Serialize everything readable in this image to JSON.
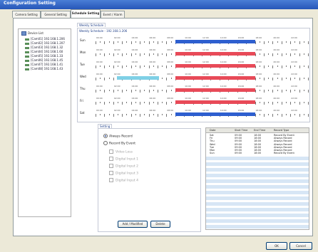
{
  "window": {
    "title": "Configuration Setting"
  },
  "tabs": [
    {
      "label": "Camera Setting",
      "active": false
    },
    {
      "label": "General Setting",
      "active": false
    },
    {
      "label": "Schedule Setting",
      "active": true
    },
    {
      "label": "Event / Alarm",
      "active": false
    }
  ],
  "device_list": {
    "root_label": "Device List",
    "items": [
      {
        "label": "[Cam01] 192.168.1.206"
      },
      {
        "label": "[Cam02] 192.168.1.207"
      },
      {
        "label": "[Cam03] 192.168.1.32"
      },
      {
        "label": "[Cam04] 192.168.1.60"
      },
      {
        "label": "[Cam05] 192.168.1.33"
      },
      {
        "label": "[Cam06] 192.168.1.45"
      },
      {
        "label": "[Cam07] 192.168.1.41"
      },
      {
        "label": "[Cam08] 192.168.1.43"
      }
    ]
  },
  "weekly": {
    "group_title": "Weekly Schedule",
    "subtitle": "Weekly Schedule - 192.168.1.206",
    "tick_labels": [
      "00:00",
      "02:00",
      "04:00",
      "06:00",
      "08:00",
      "10:00",
      "12:00",
      "14:00",
      "16:00",
      "18:00",
      "20:00",
      "22:00"
    ],
    "days": [
      {
        "name": "Sun",
        "segments": [
          {
            "start": 9,
            "end": 18,
            "color": "#2e5fcf"
          }
        ]
      },
      {
        "name": "Mon",
        "segments": [
          {
            "start": 9,
            "end": 18,
            "color": "#e84a58"
          }
        ]
      },
      {
        "name": "Tue",
        "segments": [
          {
            "start": 9,
            "end": 18,
            "color": "#e84a58"
          }
        ]
      },
      {
        "name": "Wed",
        "segments": [
          {
            "start": 2.4,
            "end": 7.2,
            "color": "#7fd0e6"
          },
          {
            "start": 9,
            "end": 18,
            "color": "#e84a58"
          }
        ]
      },
      {
        "name": "Thu",
        "segments": [
          {
            "start": 9,
            "end": 18,
            "color": "#e84a58"
          }
        ]
      },
      {
        "name": "Fri",
        "segments": [
          {
            "start": 9,
            "end": 18,
            "color": "#e84a58"
          }
        ]
      },
      {
        "name": "Sat",
        "segments": [
          {
            "start": 9,
            "end": 18,
            "color": "#2e5fcf"
          }
        ]
      }
    ]
  },
  "setting": {
    "group_title": "Setting",
    "always_record": "Always Record",
    "record_by_event": "Record By Event",
    "checkboxes": [
      "Video Loss",
      "Digital Input 1",
      "Digital Input 2",
      "Digital Input 3",
      "Digital Input 4"
    ],
    "add_modified_label": "Add / Modified",
    "delete_label": "Delete"
  },
  "table": {
    "headers": [
      "Date",
      "Start Time",
      "End Time",
      "Record Type"
    ],
    "rows": [
      [
        "Sat",
        "09:00",
        "18:00",
        "Record By Event"
      ],
      [
        "Fri",
        "09:00",
        "18:00",
        "Always Record"
      ],
      [
        "Thu",
        "09:00",
        "18:00",
        "Always Record"
      ],
      [
        "Wed",
        "09:00",
        "18:00",
        "Always Record"
      ],
      [
        "Tue",
        "09:00",
        "18:00",
        "Always Record"
      ],
      [
        "Mon",
        "09:00",
        "18:00",
        "Always Record"
      ],
      [
        "Sun",
        "09:00",
        "18:00",
        "Record By Event"
      ]
    ]
  },
  "footer": {
    "ok_label": "OK",
    "cancel_label": "Cancel"
  }
}
